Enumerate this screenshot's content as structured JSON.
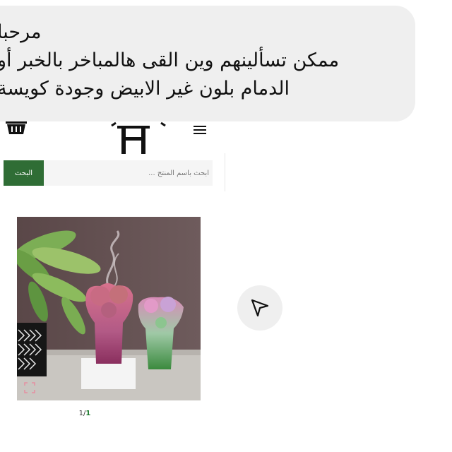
{
  "message": {
    "lines": [
      "مرحبا",
      "ممكن تسألينهم وين القى هالمباخر بالخبر أو",
      "الدمام بلون غير الابيض وجودة كويسة"
    ]
  },
  "site": {
    "logo_text": "H"
  },
  "search": {
    "placeholder": "ابحث باسم المنتج ...",
    "button_label": "البحث"
  },
  "gallery": {
    "current_page": "1",
    "separator": "/",
    "total_pages": "1"
  },
  "icons": {
    "cart": "basket-icon",
    "menu": "hamburger-menu-icon",
    "send": "send-paper-plane-icon",
    "expand": "expand-icon"
  },
  "colors": {
    "bubble": "#efefef",
    "search_button": "#2f6d35",
    "pager_active": "#1e7a2e"
  }
}
